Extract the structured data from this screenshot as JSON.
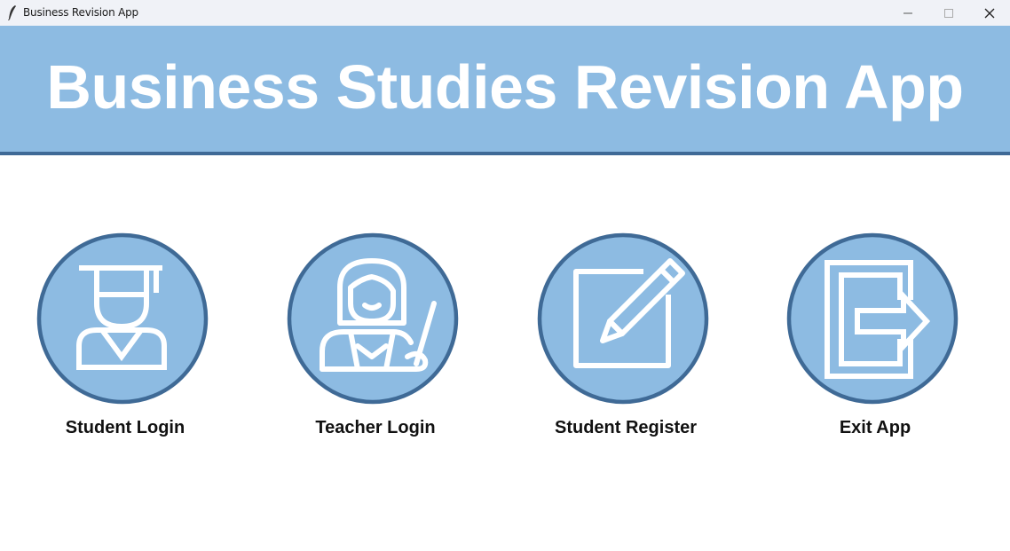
{
  "window": {
    "title": "Business Revision App",
    "app_icon": "feather-icon",
    "controls": [
      "minimize-icon",
      "maximize-icon",
      "close-icon"
    ]
  },
  "header": {
    "title": "Business Studies Revision App",
    "background": "#8dbbe2",
    "border_color": "#3f6a96"
  },
  "menu": {
    "items": [
      {
        "label": "Student Login",
        "icon": "graduate-icon"
      },
      {
        "label": "Teacher Login",
        "icon": "teacher-icon"
      },
      {
        "label": "Student Register",
        "icon": "edit-icon"
      },
      {
        "label": "Exit App",
        "icon": "exit-icon"
      }
    ],
    "circle_fill": "#8dbbe2",
    "circle_border": "#3f6a96"
  }
}
